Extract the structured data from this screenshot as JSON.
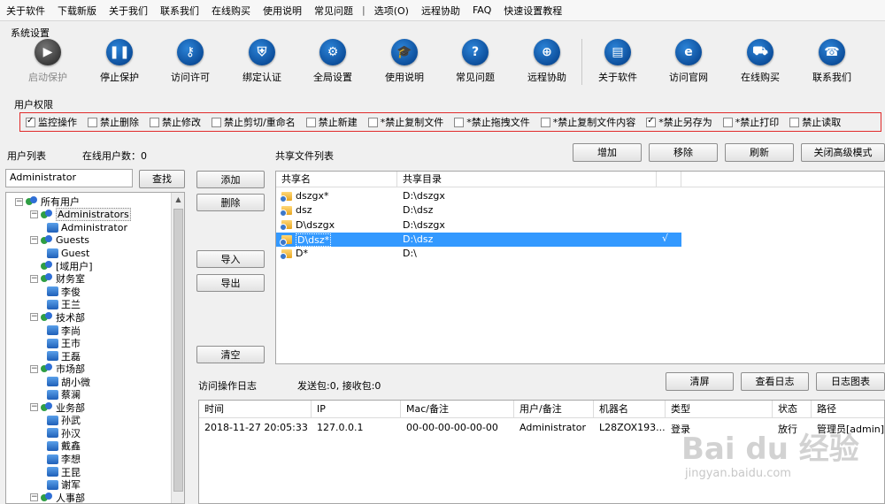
{
  "menu": [
    "关于软件",
    "下载新版",
    "关于我们",
    "联系我们",
    "在线购买",
    "使用说明",
    "常见问题",
    "|",
    "选项(O)",
    "远程协助",
    "FAQ",
    "快速设置教程"
  ],
  "sections": {
    "system": "系统设置",
    "perms": "用户权限",
    "user_list": "用户列表",
    "online_users": "在线用户数：0",
    "shared_files": "共享文件列表",
    "access_log": "访问操作日志",
    "packets": "发送包:0, 接收包:0"
  },
  "toolbar": [
    {
      "label": "启动保护",
      "icon": "play-icon",
      "glyph": "▶",
      "disabled": true
    },
    {
      "label": "停止保护",
      "icon": "pause-icon",
      "glyph": "❚❚",
      "disabled": false
    },
    {
      "label": "访问许可",
      "icon": "key-icon",
      "glyph": "⚷",
      "disabled": false
    },
    {
      "label": "绑定认证",
      "icon": "shield-icon",
      "glyph": "⛨",
      "disabled": false
    },
    {
      "label": "全局设置",
      "icon": "gear-icon",
      "glyph": "⚙",
      "disabled": false
    },
    {
      "label": "使用说明",
      "icon": "graduation-cap-icon",
      "glyph": "🎓",
      "disabled": false
    },
    {
      "label": "常见问题",
      "icon": "question-icon",
      "glyph": "?",
      "disabled": false
    },
    {
      "label": "远程协助",
      "icon": "globe-icon",
      "glyph": "⊕",
      "disabled": false
    },
    {
      "label": "关于软件",
      "icon": "book-icon",
      "glyph": "▤",
      "disabled": false
    },
    {
      "label": "访问官网",
      "icon": "browser-icon",
      "glyph": "e",
      "disabled": false
    },
    {
      "label": "在线购买",
      "icon": "cart-icon",
      "glyph": "⛟",
      "disabled": false
    },
    {
      "label": "联系我们",
      "icon": "phone-icon",
      "glyph": "☎",
      "disabled": false
    }
  ],
  "permissions": [
    {
      "label": "监控操作",
      "checked": true
    },
    {
      "label": "禁止删除",
      "checked": false
    },
    {
      "label": "禁止修改",
      "checked": false
    },
    {
      "label": "禁止剪切/重命名",
      "checked": false
    },
    {
      "label": "禁止新建",
      "checked": false
    },
    {
      "label": "*禁止复制文件",
      "checked": false
    },
    {
      "label": "*禁止拖拽文件",
      "checked": false
    },
    {
      "label": "*禁止复制文件内容",
      "checked": false
    },
    {
      "label": "*禁止另存为",
      "checked": true
    },
    {
      "label": "*禁止打印",
      "checked": false
    },
    {
      "label": "禁止读取",
      "checked": false
    }
  ],
  "search": {
    "value": "Administrator",
    "button": "查找"
  },
  "mid_buttons": {
    "add": "添加",
    "delete": "删除",
    "import": "导入",
    "export": "导出",
    "clear": "清空"
  },
  "share_buttons": {
    "add": "增加",
    "remove": "移除",
    "refresh": "刷新",
    "close_adv": "关闭高级模式"
  },
  "log_buttons": {
    "clear_screen": "清屏",
    "view_log": "查看日志",
    "log_chart": "日志图表"
  },
  "tree": [
    {
      "level": 0,
      "type": "group",
      "label": "所有用户",
      "expander": "−"
    },
    {
      "level": 1,
      "type": "group",
      "label": "Administrators",
      "expander": "−",
      "selected": true
    },
    {
      "level": 2,
      "type": "user",
      "label": "Administrator"
    },
    {
      "level": 1,
      "type": "group",
      "label": "Guests",
      "expander": "−"
    },
    {
      "level": 2,
      "type": "user",
      "label": "Guest"
    },
    {
      "level": 1,
      "type": "group",
      "label": "[域用户]",
      "expander": ""
    },
    {
      "level": 1,
      "type": "group",
      "label": "财务室",
      "expander": "−"
    },
    {
      "level": 2,
      "type": "user",
      "label": "李俊"
    },
    {
      "level": 2,
      "type": "user",
      "label": "王兰"
    },
    {
      "level": 1,
      "type": "group",
      "label": "技术部",
      "expander": "−"
    },
    {
      "level": 2,
      "type": "user",
      "label": "李尚"
    },
    {
      "level": 2,
      "type": "user",
      "label": "王市"
    },
    {
      "level": 2,
      "type": "user",
      "label": "王磊"
    },
    {
      "level": 1,
      "type": "group",
      "label": "市场部",
      "expander": "−"
    },
    {
      "level": 2,
      "type": "user",
      "label": "胡小微"
    },
    {
      "level": 2,
      "type": "user",
      "label": "蔡澜"
    },
    {
      "level": 1,
      "type": "group",
      "label": "业务部",
      "expander": "−"
    },
    {
      "level": 2,
      "type": "user",
      "label": "孙武"
    },
    {
      "level": 2,
      "type": "user",
      "label": "孙汉"
    },
    {
      "level": 2,
      "type": "user",
      "label": "戴鑫"
    },
    {
      "level": 2,
      "type": "user",
      "label": "李想"
    },
    {
      "level": 2,
      "type": "user",
      "label": "王昆"
    },
    {
      "level": 2,
      "type": "user",
      "label": "谢军"
    },
    {
      "level": 1,
      "type": "group",
      "label": "人事部",
      "expander": "−"
    }
  ],
  "share_table": {
    "headers": [
      "共享名",
      "共享目录"
    ],
    "rows": [
      {
        "name": "dszgx*",
        "dir": "D:\\dszgx",
        "mark": "",
        "selected": false
      },
      {
        "name": "dsz",
        "dir": "D:\\dsz",
        "mark": "",
        "selected": false
      },
      {
        "name": "D\\dszgx",
        "dir": "D:\\dszgx",
        "mark": "",
        "selected": false
      },
      {
        "name": "D\\dsz*",
        "dir": "D:\\dsz",
        "mark": "√",
        "selected": true
      },
      {
        "name": "D*",
        "dir": "D:\\",
        "mark": "",
        "selected": false
      }
    ]
  },
  "log_table": {
    "headers": [
      "时间",
      "IP",
      "Mac/备注",
      "用户/备注",
      "机器名",
      "类型",
      "状态",
      "路径"
    ],
    "rows": [
      [
        "2018-11-27 20:05:33",
        "127.0.0.1",
        "00-00-00-00-00-00",
        "Administrator",
        "L28ZOX193...",
        "登录",
        "放行",
        "管理员[admin]登"
      ]
    ]
  },
  "watermark": {
    "brand": "Bai du 经验",
    "url": "jingyan.baidu.com"
  }
}
